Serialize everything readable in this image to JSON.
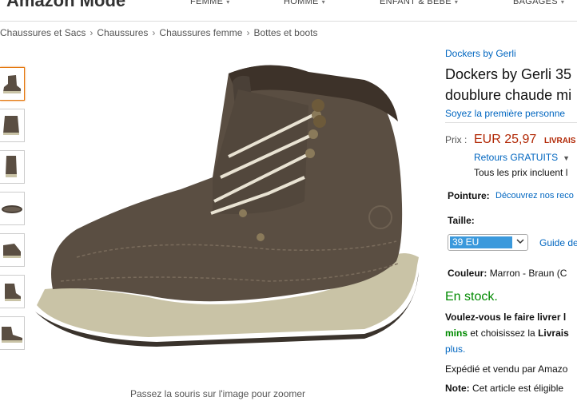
{
  "header": {
    "logo": "Amazon Mode",
    "nav": [
      {
        "label": "FEMME"
      },
      {
        "label": "HOMME"
      },
      {
        "label": "ENFANT & BÉBÉ"
      },
      {
        "label": "BAGAGES"
      }
    ]
  },
  "breadcrumb": [
    "Chaussures et Sacs",
    "Chaussures",
    "Chaussures femme",
    "Bottes et boots"
  ],
  "gallery": {
    "thumbnail_count": 7,
    "selected_index": 0,
    "zoom_hint": "Passez la souris sur l'image pour zoomer"
  },
  "product": {
    "brand_link": "Dockers by Gerli",
    "title_line1": "Dockers by Gerli 35",
    "title_line2": "doublure chaude mi",
    "review_link": "Soyez la première personne"
  },
  "price": {
    "label": "Prix :",
    "value": "EUR 25,97",
    "delivery": "LIVRAIS",
    "returns": "Retours GRATUITS",
    "tax_note": "Tous les prix incluent l"
  },
  "sizing": {
    "pointure_label": "Pointure:",
    "pointure_link": "Découvrez nos reco",
    "taille_label": "Taille:",
    "selected_size": "39 EU",
    "guide_link": "Guide de"
  },
  "color": {
    "label": "Couleur:",
    "value": "Marron - Braun (C"
  },
  "availability": {
    "stock": "En stock.",
    "deliver_line": "Voulez-vous le faire livrer l",
    "mins": "mins",
    "choose_text": " et choisissez la ",
    "livraison_bold": "Livrais",
    "plus_link": "plus.",
    "shipped_by": "Expédié et vendu par Amazo",
    "note_label": "Note:",
    "note_text": " Cet article est éligible"
  },
  "colors": {
    "link": "#0066c0",
    "price": "#b12704",
    "stock": "#008a00",
    "selected_thumb_border": "#e47911",
    "boot_leather": "#5a4e42",
    "boot_sole": "#c9c3a6"
  },
  "icons": [
    "chevron-down-icon"
  ]
}
